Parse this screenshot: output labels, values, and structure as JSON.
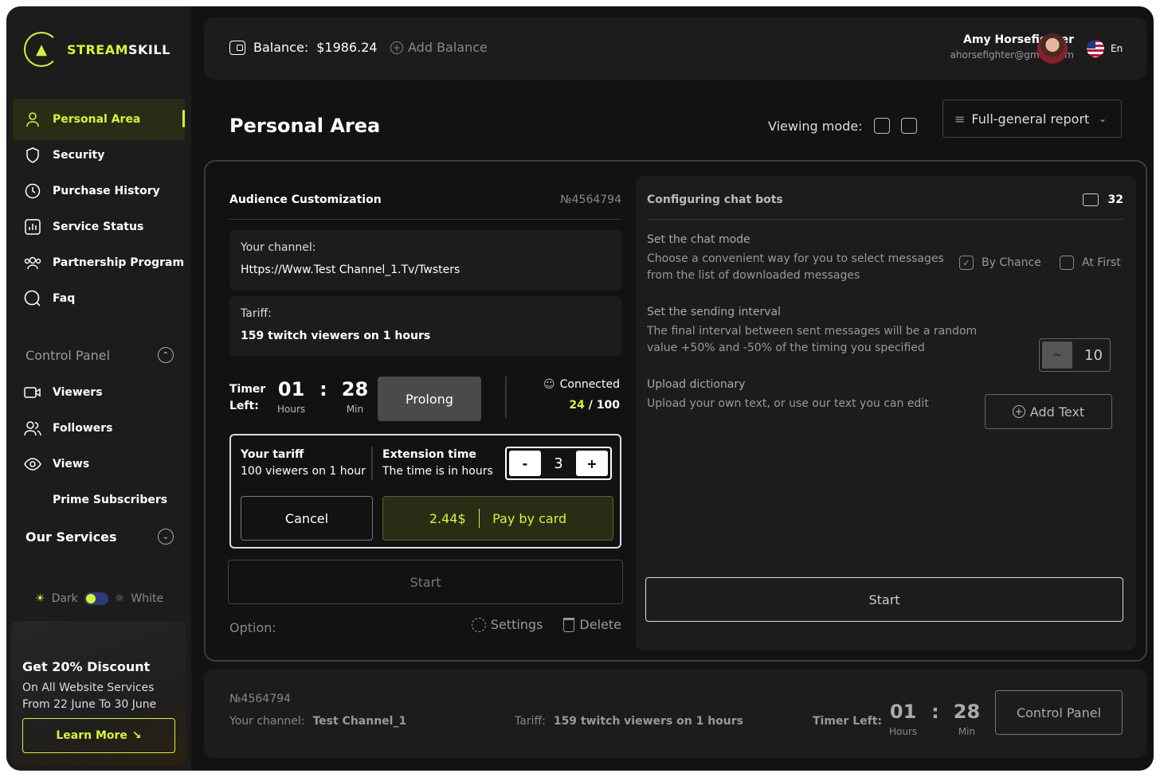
{
  "brand": {
    "part1": "STREAM",
    "part2": "SKILL"
  },
  "sidebar": {
    "items": [
      {
        "label": "Personal Area",
        "icon": "user-icon"
      },
      {
        "label": "Security",
        "icon": "shield-icon"
      },
      {
        "label": "Purchase History",
        "icon": "clock-icon"
      },
      {
        "label": "Service Status",
        "icon": "stats-icon"
      },
      {
        "label": "Partnership Program",
        "icon": "group-icon"
      },
      {
        "label": "Faq",
        "icon": "search-icon"
      }
    ],
    "control_panel_label": "Control Panel",
    "control_items": [
      {
        "label": "Viewers",
        "icon": "video-icon"
      },
      {
        "label": "Followers",
        "icon": "followers-icon"
      },
      {
        "label": "Views",
        "icon": "eye-icon"
      },
      {
        "label": "Prime Subscribers",
        "icon": ""
      }
    ],
    "our_services_label": "Our Services",
    "theme": {
      "dark": "Dark",
      "white": "White"
    },
    "promo": {
      "title": "Get 20% Discount",
      "subtitle": "On All Website Services From 22 June To 30 June",
      "button": "Learn More"
    }
  },
  "header": {
    "balance_label": "Balance:",
    "balance_value": "$1986.24",
    "add_balance": "Add Balance",
    "user_name": "Amy Horsefighter",
    "user_email": "ahorsefighter@gmail.com",
    "language": "En"
  },
  "page": {
    "title": "Personal Area",
    "viewing_mode": "Viewing mode:",
    "report_select": "Full-general report"
  },
  "audience": {
    "title": "Audience Customization",
    "number": "№4564794",
    "channel_label": "Your channel:",
    "channel_value": "Https://Www.Test Channel_1.Tv/Twsters",
    "tariff_label": "Tariff:",
    "tariff_value": "159 twitch viewers on 1 hours",
    "timer_label_1": "Timer",
    "timer_label_2": "Left:",
    "hours": "01",
    "minutes": "28",
    "colon": ":",
    "hours_unit": "Hours",
    "minutes_unit": "Min",
    "prolong": "Prolong",
    "connected_label": "Connected",
    "connected_now": "24",
    "connected_sep": "/",
    "connected_total": "100",
    "your_tariff_label": "Your tariff",
    "your_tariff_value": "100 viewers on 1 hour",
    "extension_label": "Extension time",
    "extension_desc": "The time is in hours",
    "stepper_minus": "-",
    "stepper_value": "3",
    "stepper_plus": "+",
    "cancel": "Cancel",
    "pay_amount": "2.44$",
    "pay_label": "Pay by card",
    "start": "Start",
    "option_label": "Option:",
    "settings": "Settings",
    "delete": "Delete"
  },
  "chatbots": {
    "title": "Configuring chat bots",
    "count": "32",
    "mode_title": "Set the chat mode",
    "mode_desc": "Choose a convenient way for you to select messages from the list of downloaded messages",
    "by_chance": "By Chance",
    "at_first": "At First",
    "interval_title": "Set the sending interval",
    "interval_desc": "The final interval between sent messages will be a random value +50% and -50% of the timing you specified",
    "interval_toggle": "~",
    "interval_value": "10",
    "upload_title": "Upload dictionary",
    "upload_desc": "Upload your own text, or use our text you can edit",
    "add_text": "Add Text",
    "start": "Start"
  },
  "bottom": {
    "number": "№4564794",
    "channel_label": "Your channel:",
    "channel_value": "Test Channel_1",
    "tariff_label": "Tariff:",
    "tariff_value": "159 twitch viewers on 1 hours",
    "timer_label": "Timer Left:",
    "hours": "01",
    "minutes": "28",
    "colon": ":",
    "hours_unit": "Hours",
    "minutes_unit": "Min",
    "control_panel": "Control Panel"
  },
  "colors": {
    "accent": "#d5f531",
    "background": "#121212",
    "panel": "#1c1c1c"
  }
}
